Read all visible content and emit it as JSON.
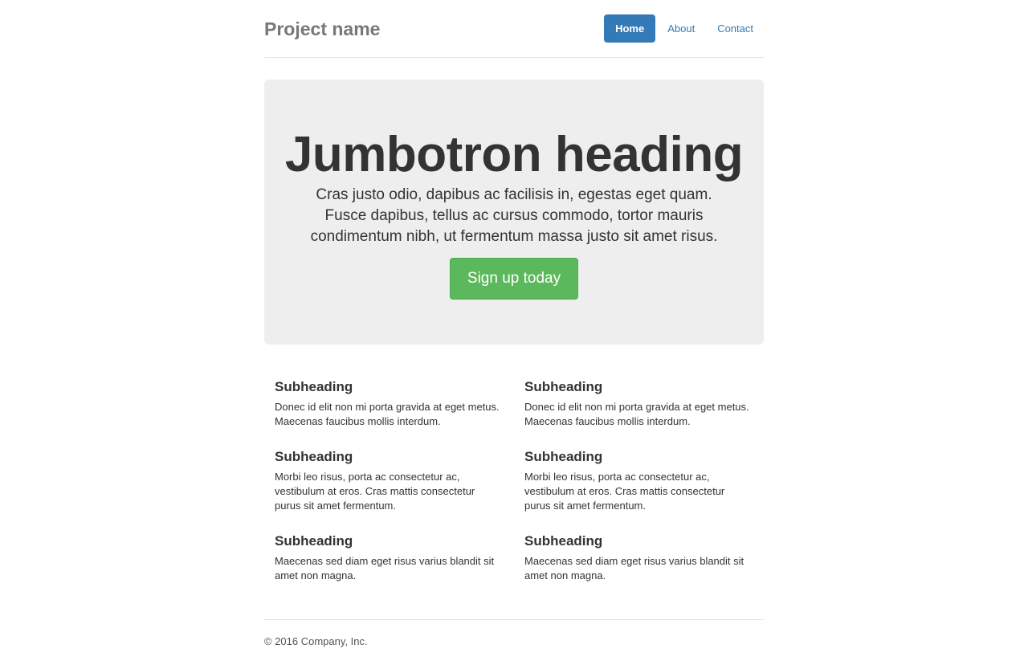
{
  "header": {
    "brand": "Project name",
    "nav": [
      {
        "label": "Home",
        "active": true
      },
      {
        "label": "About",
        "active": false
      },
      {
        "label": "Contact",
        "active": false
      }
    ]
  },
  "jumbotron": {
    "heading": "Jumbotron heading",
    "lead": "Cras justo odio, dapibus ac facilisis in, egestas eget quam. Fusce dapibus, tellus ac cursus commodo, tortor mauris condimentum nibh, ut fermentum massa justo sit amet risus.",
    "button_label": "Sign up today"
  },
  "marketing": {
    "left": [
      {
        "heading": "Subheading",
        "text": "Donec id elit non mi porta gravida at eget metus. Maecenas faucibus mollis interdum."
      },
      {
        "heading": "Subheading",
        "text": "Morbi leo risus, porta ac consectetur ac, vestibulum at eros. Cras mattis consectetur purus sit amet fermentum."
      },
      {
        "heading": "Subheading",
        "text": "Maecenas sed diam eget risus varius blandit sit amet non magna."
      }
    ],
    "right": [
      {
        "heading": "Subheading",
        "text": "Donec id elit non mi porta gravida at eget metus. Maecenas faucibus mollis interdum."
      },
      {
        "heading": "Subheading",
        "text": "Morbi leo risus, porta ac consectetur ac, vestibulum at eros. Cras mattis consectetur purus sit amet fermentum."
      },
      {
        "heading": "Subheading",
        "text": "Maecenas sed diam eget risus varius blandit sit amet non magna."
      }
    ]
  },
  "footer": {
    "copyright": "© 2016 Company, Inc."
  },
  "colors": {
    "primary": "#337ab7",
    "success": "#5cb85c",
    "jumbotron_bg": "#eeeeee",
    "brand_text": "#777777"
  }
}
